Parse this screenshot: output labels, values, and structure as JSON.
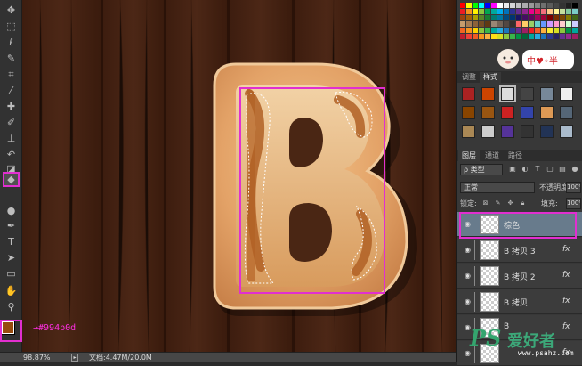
{
  "canvas": {
    "letter": "B",
    "wood_color": "#4a2614",
    "selection_color": "#e12fd0"
  },
  "toolbar": {
    "tools": [
      "move-icon",
      "marquee-icon",
      "lasso-icon",
      "quick-select-icon",
      "crop-icon",
      "eyedropper-icon",
      "healing-brush-icon",
      "brush-icon",
      "clone-stamp-icon",
      "history-brush-icon",
      "eraser-icon",
      "paint-bucket-icon",
      "dodge-icon",
      "pen-icon",
      "type-icon",
      "path-select-icon",
      "shape-icon",
      "hand-icon",
      "zoom-icon"
    ],
    "active_tool": "paint-bucket-icon"
  },
  "foreground_color": {
    "hex": "#994b0d",
    "note": "→#994b0d"
  },
  "status": {
    "zoom": "98.87%",
    "doc": "文档:4.47M/20.0M"
  },
  "style_panel": {
    "tabs": [
      "调整",
      "样式"
    ],
    "active_tab": "样式",
    "sticker_text": "中♥◦半"
  },
  "layers_panel": {
    "tabs": [
      "图层",
      "通道",
      "路径"
    ],
    "active_tab": "图层",
    "filter_label": "ρ 类型",
    "blend_mode": "正常",
    "opacity_label": "不透明度:",
    "opacity_value": "100%",
    "lock_label": "锁定:",
    "fill_label": "填充:",
    "fill_value": "100%",
    "layers": [
      {
        "name": "棕色",
        "fx": "",
        "selected": true
      },
      {
        "name": "B 拷贝 3",
        "fx": "fx",
        "selected": false
      },
      {
        "name": "B 拷贝 2",
        "fx": "fx",
        "selected": false
      },
      {
        "name": "B 拷贝",
        "fx": "fx",
        "selected": false
      },
      {
        "name": "B",
        "fx": "fx",
        "selected": false
      },
      {
        "name": "",
        "fx": "fx",
        "selected": false
      }
    ]
  },
  "watermark": {
    "logo": "PS",
    "text": "爱好者",
    "url": "www.psahz.com"
  }
}
